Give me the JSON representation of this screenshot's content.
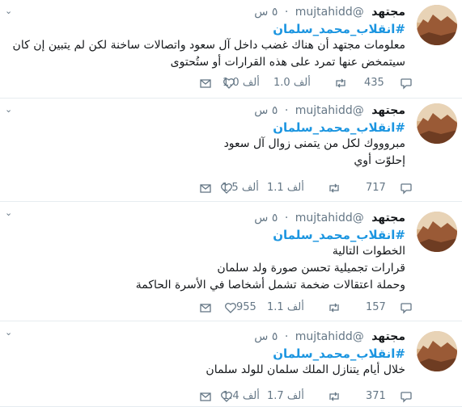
{
  "tweets": [
    {
      "name": "مجتهد",
      "handle": "@mujtahidd",
      "time": "٥ س",
      "hashtag": "#انقلاب_محمد_سلمان",
      "lines": [
        "معلومات مجتهد أن هناك غضب داخل آل سعود واتصالات ساخنة لكن لم يتبين إن كان",
        "سيتمخض عنها تمرد على هذه القرارات أو ستُحتوى"
      ],
      "replies": "435",
      "retweets": "1.0 ألف",
      "likes": "1.0 ألف"
    },
    {
      "name": "مجتهد",
      "handle": "@mujtahidd",
      "time": "٥ س",
      "hashtag": "#انقلاب_محمد_سلمان",
      "lines": [
        "مبروووك لكل من يتمنى زوال آل سعود",
        "إحلوّت أوي"
      ],
      "replies": "717",
      "retweets": "1.1 ألف",
      "likes": "1.5 ألف"
    },
    {
      "name": "مجتهد",
      "handle": "@mujtahidd",
      "time": "٥ س",
      "hashtag": "#انقلاب_محمد_سلمان",
      "lines": [
        "الخطوات التالية",
        "قرارات تجميلية تحسن صورة ولد سلمان",
        "وحملة اعتقالات ضخمة تشمل أشخاصا في الأسرة الحاكمة"
      ],
      "replies": "157",
      "retweets": "1.1 ألف",
      "likes": "955"
    },
    {
      "name": "مجتهد",
      "handle": "@mujtahidd",
      "time": "٥ س",
      "hashtag": "#انقلاب_محمد_سلمان",
      "lines": [
        "خلال أيام يتنازل الملك سلمان للولد سلمان"
      ],
      "replies": "371",
      "retweets": "1.7 ألف",
      "likes": "1.4 ألف"
    }
  ],
  "icons": {
    "reply": "reply-icon",
    "retweet": "retweet-icon",
    "like": "heart-icon",
    "message": "direct-message-icon",
    "menu": "chevron-down-icon"
  },
  "colors": {
    "hashtag": "#1b95e0",
    "secondary": "#657786",
    "divider": "#e6ecf0"
  }
}
